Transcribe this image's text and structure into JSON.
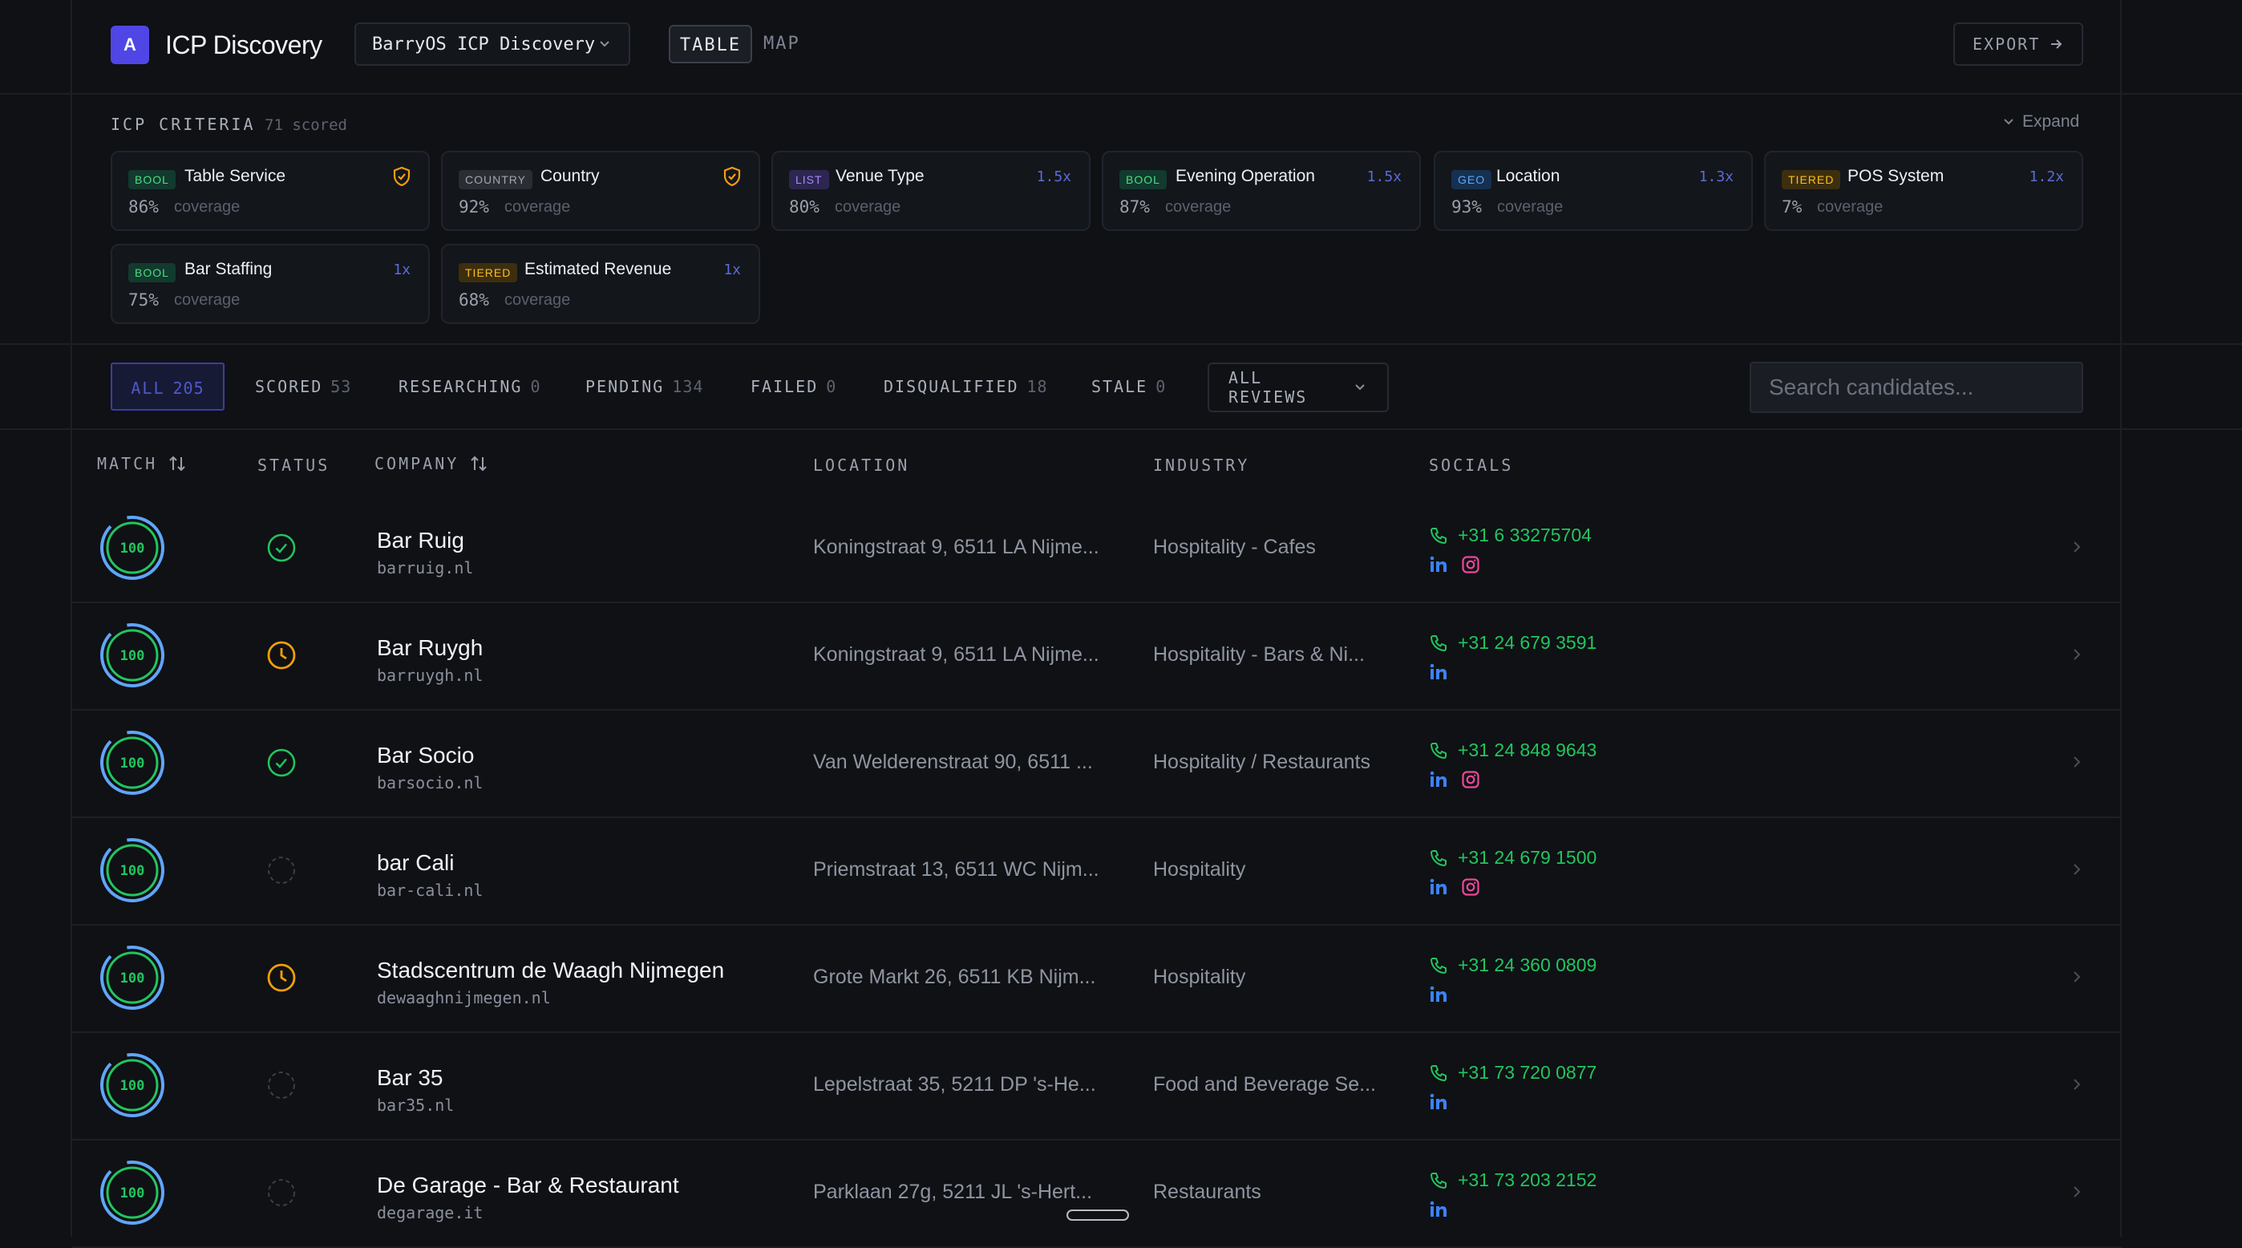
{
  "header": {
    "logo_letter": "A",
    "app_title": "ICP Discovery",
    "project_select": "BarryOS ICP Discovery",
    "view_tabs": [
      "TABLE",
      "MAP"
    ],
    "active_view": "TABLE",
    "export_label": "EXPORT"
  },
  "criteria": {
    "title": "ICP CRITERIA",
    "scored_count": "71 scored",
    "expand_label": "Expand",
    "coverage_label": "coverage",
    "cards": [
      {
        "tag": "BOOL",
        "tag_style": "bool",
        "name": "Table Service",
        "coverage": "86%",
        "weight": "",
        "shield": true
      },
      {
        "tag": "COUNTRY",
        "tag_style": "country",
        "name": "Country",
        "coverage": "92%",
        "weight": "",
        "shield": true
      },
      {
        "tag": "LIST",
        "tag_style": "list",
        "name": "Venue Type",
        "coverage": "80%",
        "weight": "1.5x",
        "shield": false
      },
      {
        "tag": "BOOL",
        "tag_style": "bool",
        "name": "Evening Operation",
        "coverage": "87%",
        "weight": "1.5x",
        "shield": false
      },
      {
        "tag": "GEO",
        "tag_style": "geo",
        "name": "Location",
        "coverage": "93%",
        "weight": "1.3x",
        "shield": false
      },
      {
        "tag": "TIERED",
        "tag_style": "tiered",
        "name": "POS System",
        "coverage": "7%",
        "weight": "1.2x",
        "shield": false
      },
      {
        "tag": "BOOL",
        "tag_style": "bool",
        "name": "Bar Staffing",
        "coverage": "75%",
        "weight": "1x",
        "shield": false
      },
      {
        "tag": "TIERED",
        "tag_style": "tiered",
        "name": "Estimated Revenue",
        "coverage": "68%",
        "weight": "1x",
        "shield": false
      }
    ]
  },
  "filters": {
    "tabs": [
      {
        "label": "ALL",
        "count": "205"
      },
      {
        "label": "SCORED",
        "count": "53"
      },
      {
        "label": "RESEARCHING",
        "count": "0"
      },
      {
        "label": "PENDING",
        "count": "134"
      },
      {
        "label": "FAILED",
        "count": "0"
      },
      {
        "label": "DISQUALIFIED",
        "count": "18"
      },
      {
        "label": "STALE",
        "count": "0"
      }
    ],
    "active": "ALL",
    "reviews_select": "ALL REVIEWS",
    "search_placeholder": "Search candidates..."
  },
  "table": {
    "columns": {
      "match": "MATCH",
      "status": "STATUS",
      "company": "COMPANY",
      "location": "LOCATION",
      "industry": "INDUSTRY",
      "socials": "SOCIALS"
    },
    "rows": [
      {
        "score": "100",
        "status": "scored",
        "company": "Bar Ruig",
        "domain": "barruig.nl",
        "location": "Koningstraat 9, 6511 LA Nijme...",
        "industry": "Hospitality - Cafes",
        "phone": "+31 6 33275704",
        "linkedin": true,
        "instagram": true
      },
      {
        "score": "100",
        "status": "pending",
        "company": "Bar Ruygh",
        "domain": "barruygh.nl",
        "location": "Koningstraat 9, 6511 LA Nijme...",
        "industry": "Hospitality - Bars & Ni...",
        "phone": "+31 24 679 3591",
        "linkedin": true,
        "instagram": false
      },
      {
        "score": "100",
        "status": "scored",
        "company": "Bar Socio",
        "domain": "barsocio.nl",
        "location": "Van Welderenstraat 90, 6511 ...",
        "industry": "Hospitality / Restaurants",
        "phone": "+31 24 848 9643",
        "linkedin": true,
        "instagram": true
      },
      {
        "score": "100",
        "status": "none",
        "company": "bar Cali",
        "domain": "bar-cali.nl",
        "location": "Priemstraat 13, 6511 WC Nijm...",
        "industry": "Hospitality",
        "phone": "+31 24 679 1500",
        "linkedin": true,
        "instagram": true
      },
      {
        "score": "100",
        "status": "pending",
        "company": "Stadscentrum de Waagh Nijmegen",
        "domain": "dewaaghnijmegen.nl",
        "location": "Grote Markt 26, 6511 KB Nijm...",
        "industry": "Hospitality",
        "phone": "+31 24 360 0809",
        "linkedin": true,
        "instagram": false
      },
      {
        "score": "100",
        "status": "none",
        "company": "Bar 35",
        "domain": "bar35.nl",
        "location": "Lepelstraat 35, 5211 DP 's-He...",
        "industry": "Food and Beverage Se...",
        "phone": "+31 73 720 0877",
        "linkedin": true,
        "instagram": false
      },
      {
        "score": "100",
        "status": "none",
        "company": "De Garage - Bar & Restaurant",
        "domain": "degarage.it",
        "location": "Parklaan 27g, 5211 JL 's-Hert...",
        "industry": "Restaurants",
        "phone": "+31 73 203 2152",
        "linkedin": true,
        "instagram": false
      }
    ]
  },
  "colors": {
    "accent": "#4f46e5",
    "success": "#22c55e",
    "warning": "#f59e0b",
    "ring_outer": "#60a5fa",
    "linkedin": "#3b82f6",
    "instagram": "#ec4899"
  }
}
